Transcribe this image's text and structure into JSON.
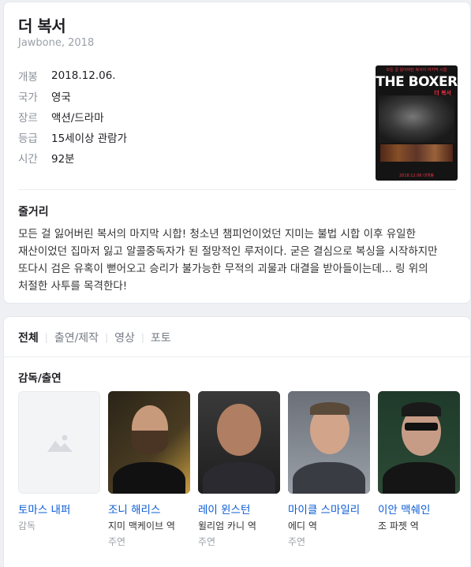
{
  "movie": {
    "title": "더 복서",
    "subtitle": "Jawbone, 2018",
    "info": [
      {
        "key": "개봉",
        "value": "2018.12.06."
      },
      {
        "key": "국가",
        "value": "영국"
      },
      {
        "key": "장르",
        "value": "액션/드라마"
      },
      {
        "key": "등급",
        "value": "15세이상 관람가"
      },
      {
        "key": "시간",
        "value": "92분"
      }
    ],
    "poster": {
      "top_text": "모든 걸 잃어버린 복서의 마지막 시합",
      "title": "THE BOXER",
      "korean_title": "더 복서",
      "bottom_text": "2018.12.06 대개봉"
    }
  },
  "synopsis": {
    "heading": "줄거리",
    "text": "모든 걸 잃어버린 복서의 마지막 시합! 청소년 챔피언이었던 지미는 불법 시합 이후 유일한 재산이었던 집마저 잃고 알콜중독자가 된 절망적인 루저이다. 굳은 결심으로 복싱을 시작하지만 또다시 검은 유혹이 뻗어오고 승리가 불가능한 무적의 괴물과 대결을 받아들이는데... 링 위의 처절한 사투를 목격한다!"
  },
  "tabs": [
    "전체",
    "출연/제작",
    "영상",
    "포토"
  ],
  "cast_section": {
    "heading": "감독/출연",
    "people": [
      {
        "name": "토마스 내퍼",
        "role": "감독",
        "kind": ""
      },
      {
        "name": "조니 해리스",
        "role": "지미 맥케이브 역",
        "kind": "주연"
      },
      {
        "name": "레이 윈스턴",
        "role": "윌리엄 카니 역",
        "kind": "주연"
      },
      {
        "name": "마이클 스마일리",
        "role": "에디 역",
        "kind": "주연"
      },
      {
        "name": "이안 맥쉐인",
        "role": "조 파젯 역",
        "kind": "주연"
      }
    ]
  },
  "icons": {
    "placeholder": "image-placeholder-icon"
  },
  "colors": {
    "link": "#0b5cd5",
    "muted": "#9aa0a8",
    "poster_accent": "#ee3344"
  }
}
